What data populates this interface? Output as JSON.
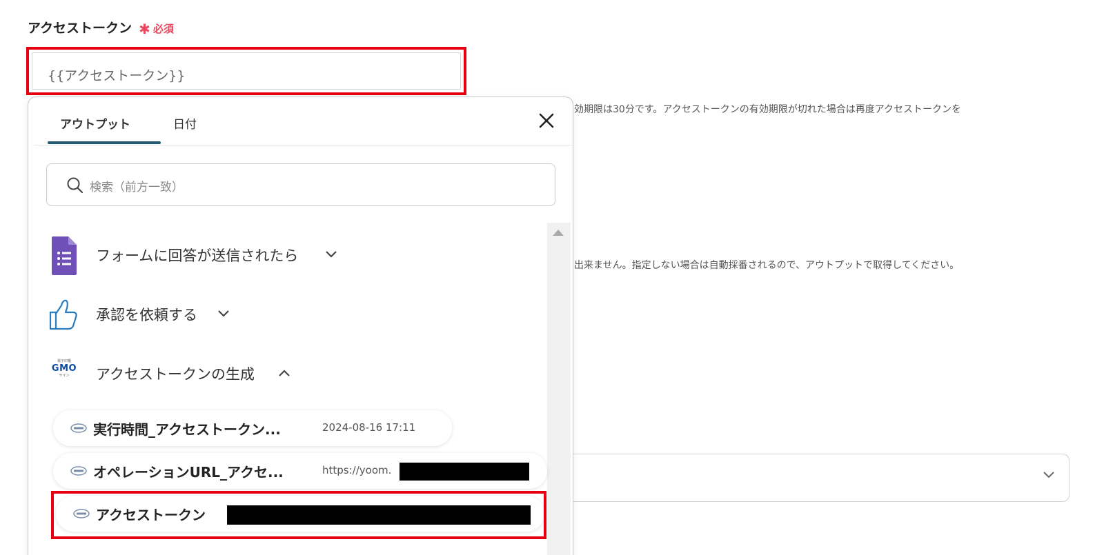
{
  "field": {
    "label": "アクセストークン",
    "required_mark": "✱",
    "required_text": "必須",
    "value": "{{アクセストークン}}"
  },
  "help": {
    "line1": "効期限は30分です。アクセストークンの有効期限が切れた場合は再度アクセストークンを",
    "line2": "出来ません。指定しない場合は自動採番されるので、アウトプットで取得してください。"
  },
  "popup": {
    "tabs": [
      {
        "label": "アウトプット",
        "active": true
      },
      {
        "label": "日付",
        "active": false
      }
    ],
    "search_placeholder": "検索（前方一致）",
    "groups": [
      {
        "label": "フォームに回答が送信されたら",
        "icon": "google-forms-icon",
        "expanded": false
      },
      {
        "label": "承認を依頼する",
        "icon": "thumbs-up-icon",
        "expanded": false
      },
      {
        "label": "アクセストークンの生成",
        "icon": "gmo-sign-icon",
        "expanded": true
      }
    ],
    "items": [
      {
        "name": "実行時間_アクセストークン...",
        "value": "2024-08-16 17:11"
      },
      {
        "name": "オペレーションURL_アクセ...",
        "value": "https://yoom."
      },
      {
        "name": "アクセストークン",
        "value": ""
      }
    ],
    "gmo_logo": {
      "tagline": "電子印鑑",
      "brand": "GMO",
      "sub": "サイン"
    }
  },
  "colors": {
    "highlight": "#e60012",
    "required": "#e8495f",
    "tab_underline": "#1f5a70",
    "forms_purple": "#6f4fb8",
    "thumb_blue": "#2b7bbd"
  }
}
